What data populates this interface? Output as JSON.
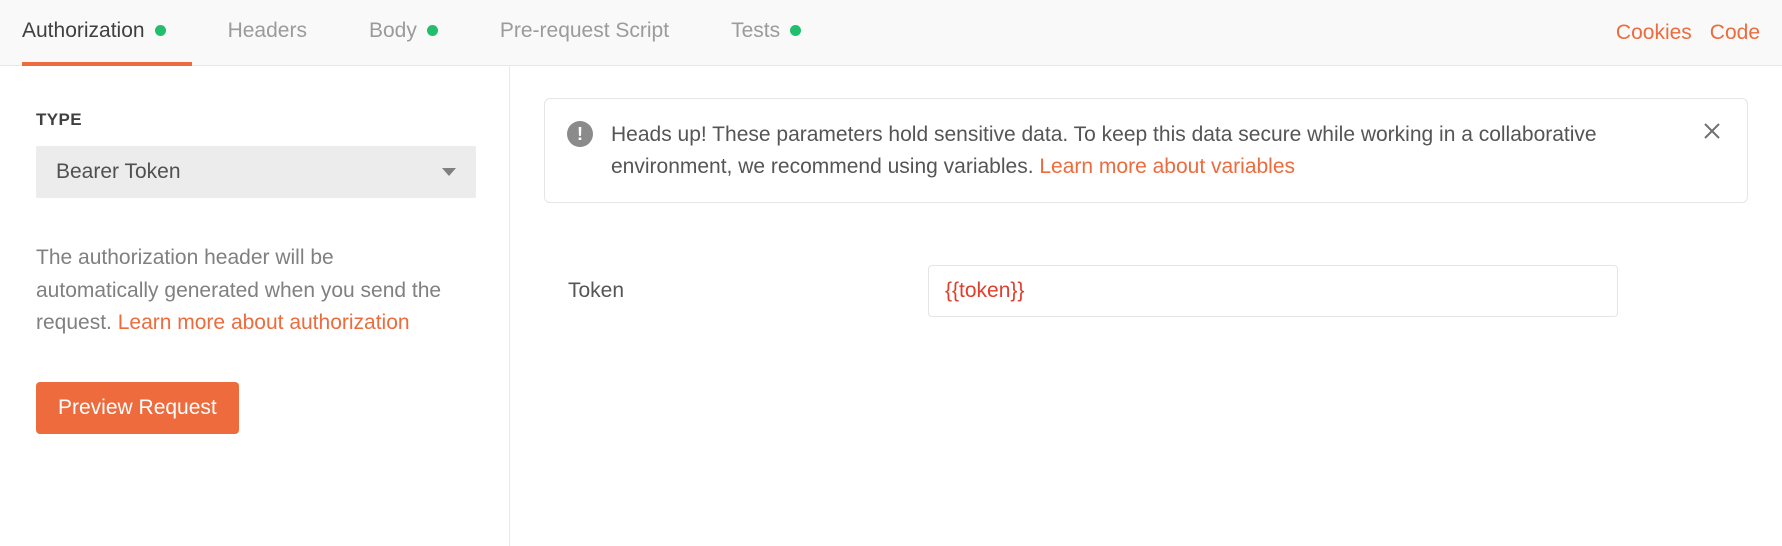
{
  "tabs": [
    {
      "label": "Authorization",
      "active": true,
      "dot": true
    },
    {
      "label": "Headers",
      "active": false,
      "dot": false
    },
    {
      "label": "Body",
      "active": false,
      "dot": true
    },
    {
      "label": "Pre-request Script",
      "active": false,
      "dot": false
    },
    {
      "label": "Tests",
      "active": false,
      "dot": true
    }
  ],
  "actions": {
    "cookies": "Cookies",
    "code": "Code"
  },
  "sidebar": {
    "type_label": "TYPE",
    "auth_type_selected": "Bearer Token",
    "help_text_pre": "The authorization header will be automatically generated when you send the request. ",
    "help_link": "Learn more about authorization",
    "preview_button": "Preview Request"
  },
  "alert": {
    "text_pre": "Heads up! These parameters hold sensitive data. To keep this data secure while working in a collaborative environment, we recommend using variables. ",
    "link": "Learn more about variables",
    "icon_glyph": "!"
  },
  "form": {
    "token_label": "Token",
    "token_value": "{{token}}"
  }
}
